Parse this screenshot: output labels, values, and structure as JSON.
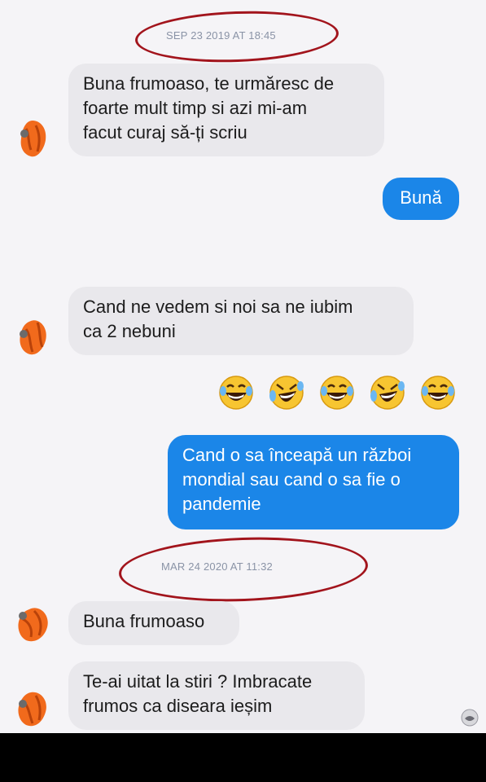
{
  "conversation": {
    "timestamps": [
      "SEP 23 2019 AT 18:45",
      "MAR 24 2020 AT 11:32"
    ],
    "messages": [
      {
        "side": "in",
        "lines": [
          "Buna frumoaso, te urmăresc de",
          "foarte mult timp si azi mi-am",
          "facut curaj să-ți scriu"
        ]
      },
      {
        "side": "out",
        "lines": [
          "Bună"
        ]
      },
      {
        "side": "in",
        "lines": [
          "Cand ne vedem si noi sa ne iubim",
          "ca 2 nebuni"
        ]
      },
      {
        "side": "in",
        "emojis": [
          "laughing-emoji",
          "tears-of-joy-emoji",
          "laughing-emoji",
          "tears-of-joy-emoji",
          "laughing-emoji"
        ]
      },
      {
        "side": "out",
        "lines": [
          "Cand o sa înceapă un război",
          "mondial sau cand o sa fie o",
          "pandemie"
        ]
      },
      {
        "side": "in",
        "lines": [
          "Buna frumoaso"
        ]
      },
      {
        "side": "in",
        "lines": [
          "Te-ai uitat la stiri ? Imbracate",
          "frumos ca diseara ieșim"
        ]
      }
    ]
  },
  "colors": {
    "outgoing_bubble": "#1b86e8",
    "incoming_bubble": "#e9e8ec",
    "annotation_red": "#a2141c"
  },
  "icons": [
    "avatar-profile-photo",
    "laughing-emoji",
    "tears-of-joy-emoji",
    "seen-avatar-icon"
  ]
}
